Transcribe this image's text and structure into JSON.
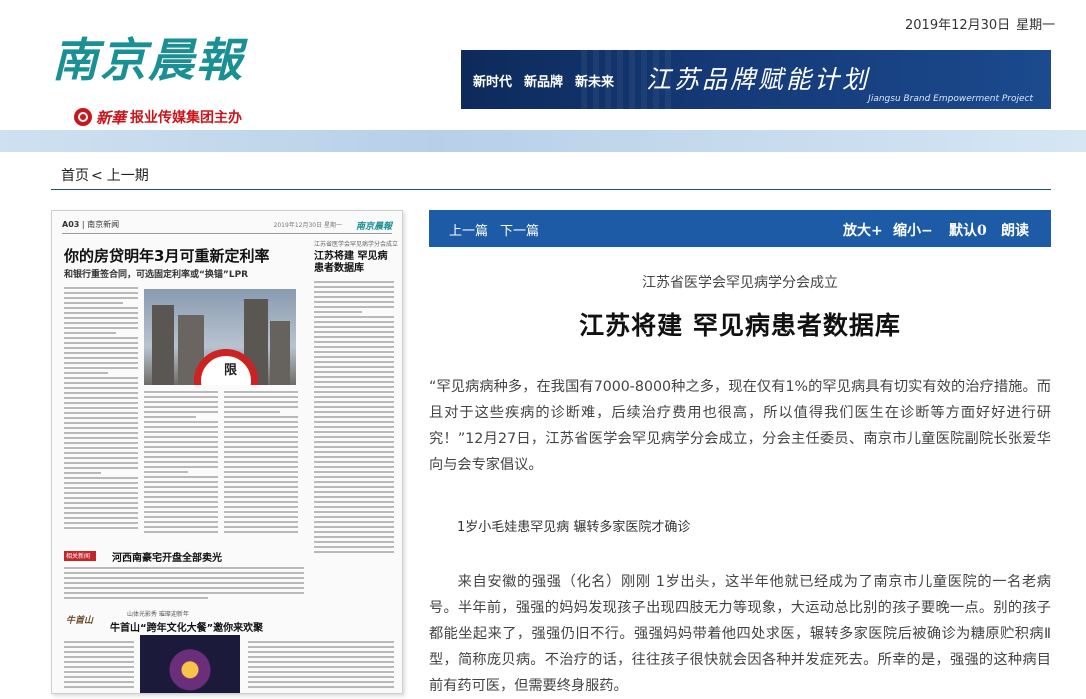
{
  "header": {
    "site_name": "南京晨報",
    "group_logo": "新華",
    "group_name": "报业传媒集团主办",
    "date": "2019年12月30日",
    "weekday": "星期一",
    "banner": {
      "slogans": [
        "新时代",
        "新品牌",
        "新未来"
      ],
      "title": "江苏品牌赋能计划",
      "subtitle": "Jiangsu Brand Empowerment Project"
    }
  },
  "breadcrumb": {
    "home": "首页",
    "separator": "<",
    "previous": "上一期"
  },
  "page_thumbnail": {
    "page_label": "A03",
    "section": "南京新闻",
    "logo": "南京晨報",
    "date": "2019年12月30日 星期一",
    "headline": "你的房贷明年3月可重新定利率",
    "subheadline": "和银行重签合同，可选固定利率或“换锚”LPR",
    "side_kicker": "江苏省医学会罕见病学分会成立",
    "side_title": "江苏将建 罕见病患者数据库",
    "sign_text": "限",
    "red_tag": "相关新闻",
    "henan_title": "河西南豪宅开盘全部卖光",
    "ad_logo": "牛首山",
    "ad_kicker": "山体光影秀 璀璨迎新年",
    "ad_title": "牛首山“跨年文化大餐”邀你来欢聚"
  },
  "toolbar": {
    "prev_article": "上一篇",
    "next_article": "下一篇",
    "zoom_in": "放大+",
    "zoom_out": "缩小−",
    "default": "默认0",
    "read_aloud": "朗读"
  },
  "article": {
    "kicker": "江苏省医学会罕见病学分会成立",
    "title": "江苏将建 罕见病患者数据库",
    "paragraph1": "“罕见病病种多，在我国有7000-8000种之多，现在仅有1%的罕见病具有切实有效的治疗措施。而且对于这些疾病的诊断难，后续治疗费用也很高，所以值得我们医生在诊断等方面好好进行研究！”12月27日，江苏省医学会罕见病学分会成立，分会主任委员、南京市儿童医院副院长张爱华向与会专家倡议。",
    "subheading": "1岁小毛娃患罕见病 辗转多家医院才确诊",
    "paragraph2": "来自安徽的强强（化名）刚刚 1岁出头，这半年他就已经成为了南京市儿童医院的一名老病号。半年前，强强的妈妈发现孩子出现四肢无力等现象，大运动总比别的孩子要晚一点。别的孩子都能坐起来了，强强仍旧不行。强强妈妈带着他四处求医，辗转多家医院后被确诊为糖原贮积病Ⅱ型，简称庞贝病。不治疗的话，往往孩子很快就会因各种并发症死去。所幸的是，强强的这种病目前有药可医，但需要终身服药。"
  },
  "colors": {
    "brand_teal": "#1a8f94",
    "toolbar_blue": "#1d5ba6",
    "group_red": "#c8161d"
  }
}
